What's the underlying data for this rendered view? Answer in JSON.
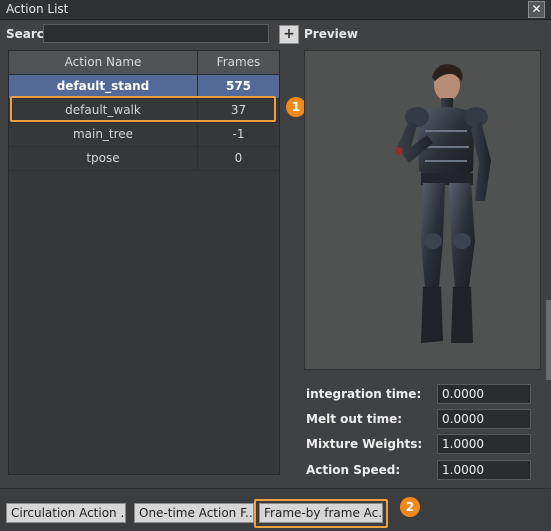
{
  "window": {
    "title": "Action List"
  },
  "search": {
    "label": "Search",
    "value": "",
    "add_label": "+"
  },
  "table": {
    "headers": [
      "Action Name",
      "Frames"
    ],
    "rows": [
      {
        "name": "default_stand",
        "frames": "575",
        "selected": true
      },
      {
        "name": "default_walk",
        "frames": "37",
        "selected": false
      },
      {
        "name": "main_tree",
        "frames": "-1",
        "selected": false
      },
      {
        "name": "tpose",
        "frames": "0",
        "selected": false
      }
    ]
  },
  "preview": {
    "label": "Preview"
  },
  "properties": [
    {
      "label": "integration time:",
      "value": "0.0000"
    },
    {
      "label": "Melt out time:",
      "value": "0.0000"
    },
    {
      "label": "Mixture Weights:",
      "value": "1.0000"
    },
    {
      "label": "Action Speed:",
      "value": "1.0000"
    }
  ],
  "buttons": {
    "circulation": "Circulation Action ...",
    "one_time": "One-time Action F...",
    "frame_by_frame": "Frame-by frame Ac..."
  },
  "callouts": [
    "1",
    "2"
  ],
  "colors": {
    "selected_row": "#536a99",
    "callout": "#f08a1c"
  }
}
